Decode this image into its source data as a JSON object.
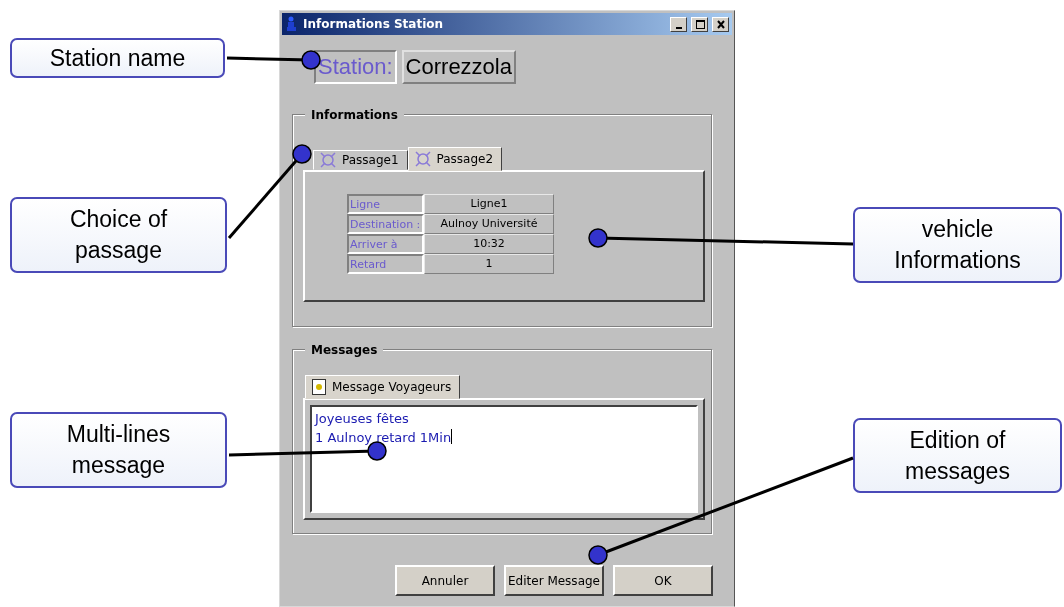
{
  "window": {
    "title": "Informations Station"
  },
  "station": {
    "label": "Station:",
    "value": "Correzzola"
  },
  "informations": {
    "title": "Informations",
    "tabs": [
      {
        "label": "Passage1",
        "selected": false
      },
      {
        "label": "Passage2",
        "selected": true
      }
    ],
    "rows": [
      {
        "label": "Ligne",
        "value": "Ligne1"
      },
      {
        "label": "Destination :",
        "value": "Aulnoy Université"
      },
      {
        "label": "Arriver à",
        "value": "10:32"
      },
      {
        "label": "Retard",
        "value": "1"
      }
    ]
  },
  "messages": {
    "title": "Messages",
    "tab": {
      "label": "Message Voyageurs",
      "selected": true
    },
    "text": "Joyeuses fêtes\n1 Aulnoy retard 1Min"
  },
  "buttons": [
    "Annuler",
    "Editer Message",
    "OK"
  ],
  "callouts": [
    {
      "text": "Station name"
    },
    {
      "text": "Choice of\npassage"
    },
    {
      "text": "Multi-lines\nmessage"
    },
    {
      "text": "vehicle\nInformations"
    },
    {
      "text": "Edition of\nmessages"
    }
  ]
}
